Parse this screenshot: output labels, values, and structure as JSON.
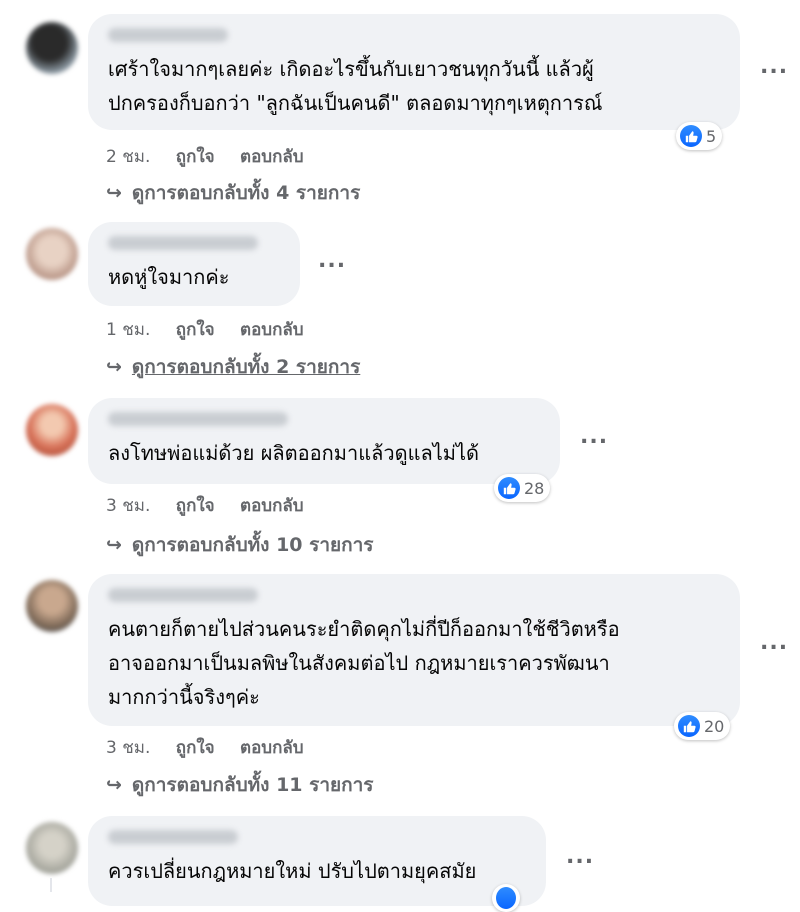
{
  "comments": [
    {
      "text_lines": [
        "เศร้าใจมากๆเลยค่ะ เกิดอะไรขึ้นกับเยาวชนทุกวันนี้ แล้วผู้",
        "ปกครองก็บอกว่า \"ลูกฉันเป็นคนดี\" ตลอดมาทุกๆเหตุการณ์"
      ],
      "likes": "5",
      "time": "2 ชม.",
      "like_label": "ถูกใจ",
      "reply_label": "ตอบกลับ",
      "view_replies": "ดูการตอบกลับทั้ง 4 รายการ",
      "avatar_color": "#5a6470"
    },
    {
      "text_lines": [
        "หดหู่ใจมากค่ะ"
      ],
      "likes": "",
      "time": "1 ชม.",
      "like_label": "ถูกใจ",
      "reply_label": "ตอบกลับ",
      "view_replies": "ดูการตอบกลับทั้ง 2 รายการ",
      "avatar_color": "#c7a99a"
    },
    {
      "text_lines": [
        "ลงโทษพ่อแม่ด้วย ผลิตออกมาแล้วดูแลไม่ได้"
      ],
      "likes": "28",
      "time": "3 ชม.",
      "like_label": "ถูกใจ",
      "reply_label": "ตอบกลับ",
      "view_replies": "ดูการตอบกลับทั้ง 10 รายการ",
      "avatar_color": "#d8735a"
    },
    {
      "text_lines": [
        "คนตายก็ตายไปส่วนคนระยำติดคุกไม่กี่ปีก็ออกมาใช้ชีวิตหรือ",
        "อาจออกมาเป็นมลพิษในสังคมต่อไป กฎหมายเราควรพัฒนา",
        "มากกว่านี้จริงๆค่ะ"
      ],
      "likes": "20",
      "time": "3 ชม.",
      "like_label": "ถูกใจ",
      "reply_label": "ตอบกลับ",
      "view_replies": "ดูการตอบกลับทั้ง 11 รายการ",
      "avatar_color": "#8a7868"
    },
    {
      "text_lines": [
        "ควรเปลี่ยนกฎหมายใหม่ ปรับไปตามยุคสมัย"
      ],
      "likes": "",
      "time": "",
      "like_label": "",
      "reply_label": "",
      "view_replies": "",
      "avatar_color": "#a9a9a0"
    }
  ],
  "more_options": "...",
  "reply_arrow": "↪",
  "colors": {
    "bubble": "#f0f2f5",
    "meta_text": "#65676b",
    "like_blue": "#0a66ff"
  },
  "icons": {
    "like": "thumbs-up-icon",
    "more": "more-options-icon",
    "reply": "reply-arrow-icon"
  }
}
